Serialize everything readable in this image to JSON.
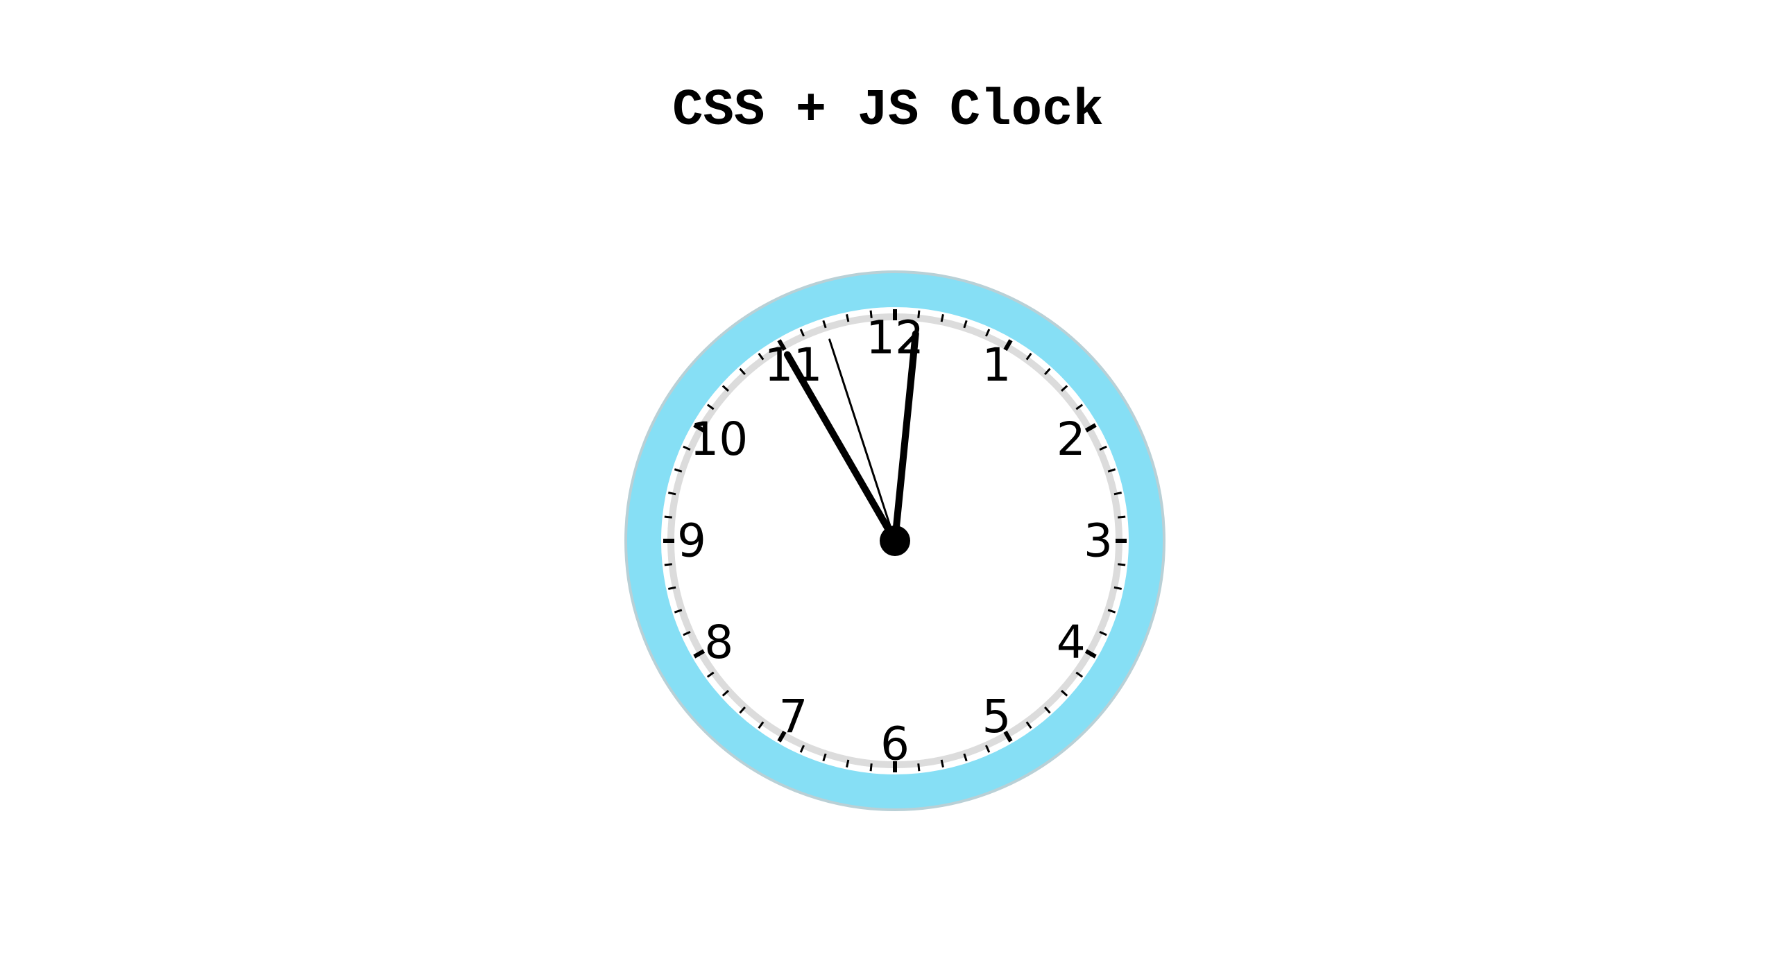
{
  "page": {
    "title": "CSS + JS Clock"
  },
  "clock": {
    "numerals": [
      "12",
      "1",
      "2",
      "3",
      "4",
      "5",
      "6",
      "7",
      "8",
      "9",
      "10",
      "11"
    ],
    "time": {
      "hours": 11,
      "minutes": 0,
      "seconds": 57
    },
    "colors": {
      "bezel": "#86dff5",
      "bezel_edge": "#b9d0d6",
      "face": "#ffffff",
      "inner_ring": "#dcdcdc",
      "ticks": "#000000",
      "hands": "#000000"
    }
  }
}
